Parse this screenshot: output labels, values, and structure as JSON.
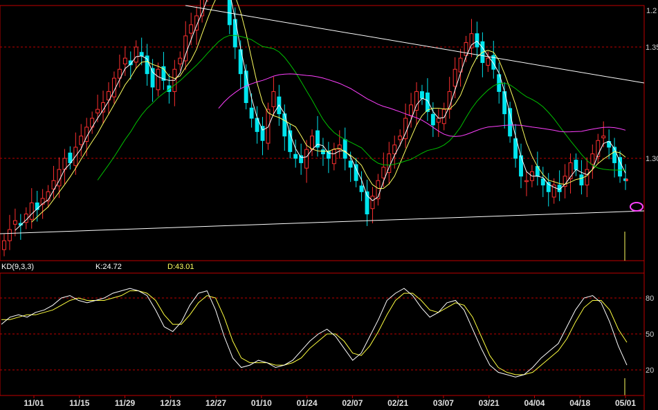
{
  "top_header": {
    "fragments": [
      "",
      "",
      "",
      "",
      ""
    ]
  },
  "main_panel": {
    "price_axis_labels": [
      {
        "text": "1.2",
        "value": 1.4
      },
      {
        "text": "1.35",
        "value": 1.35
      },
      {
        "text": "1.30",
        "value": 1.3
      }
    ]
  },
  "kd_panel": {
    "title": "KD(9,3,3)",
    "k_label": "K:24.72",
    "d_label": "D:43.01",
    "axis_labels": [
      {
        "text": "80",
        "value": 80
      },
      {
        "text": "50",
        "value": 50
      },
      {
        "text": "20",
        "value": 20
      }
    ]
  },
  "x_axis": {
    "labels": [
      "11/01",
      "11/15",
      "11/29",
      "12/13",
      "12/27",
      "01/10",
      "01/24",
      "02/07",
      "02/21",
      "03/07",
      "03/21",
      "04/04",
      "04/18",
      "05/01"
    ]
  },
  "colors": {
    "background": "#000000",
    "grid": "#c00000",
    "bull": "#ff3030",
    "bear": "#00e5ee",
    "ma_short": "#ffffff",
    "ma_mid": "#ffff60",
    "ma_long": "#00c000",
    "ma_longest": "#ff40ff",
    "k_line": "#ffffff",
    "d_line": "#ffff40",
    "trendline": "#ffffff",
    "marker": "#ff40ff"
  },
  "chart_data": [
    {
      "type": "candlestick",
      "title": "",
      "x_labels": [
        "11/01",
        "11/15",
        "11/29",
        "12/13",
        "12/27",
        "01/10",
        "01/24",
        "02/07",
        "02/21",
        "03/07",
        "03/21",
        "04/04",
        "04/18",
        "05/01"
      ],
      "ylim": [
        1.26,
        1.4
      ],
      "close_series": [
        1.263,
        1.268,
        1.272,
        1.27,
        1.275,
        1.28,
        1.277,
        1.282,
        1.285,
        1.29,
        1.295,
        1.3,
        1.298,
        1.305,
        1.31,
        1.314,
        1.318,
        1.322,
        1.325,
        1.33,
        1.336,
        1.34,
        1.345,
        1.342,
        1.35,
        1.346,
        1.338,
        1.332,
        1.34,
        1.335,
        1.33,
        1.34,
        1.345,
        1.355,
        1.36,
        1.364,
        1.372,
        1.38,
        1.383,
        1.386,
        1.378,
        1.36,
        1.35,
        1.338,
        1.325,
        1.318,
        1.312,
        1.308,
        1.322,
        1.33,
        1.32,
        1.31,
        1.303,
        1.3,
        1.298,
        1.304,
        1.31,
        1.305,
        1.302,
        1.3,
        1.304,
        1.306,
        1.3,
        1.296,
        1.29,
        1.285,
        1.275,
        1.283,
        1.29,
        1.296,
        1.302,
        1.306,
        1.31,
        1.318,
        1.324,
        1.33,
        1.327,
        1.321,
        1.315,
        1.318,
        1.322,
        1.33,
        1.34,
        1.345,
        1.352,
        1.356,
        1.35,
        1.343,
        1.345,
        1.34,
        1.33,
        1.32,
        1.31,
        1.3,
        1.292,
        1.29,
        1.294,
        1.292,
        1.288,
        1.285,
        1.288,
        1.285,
        1.292,
        1.298,
        1.295,
        1.288,
        1.295,
        1.302,
        1.308,
        1.31,
        1.305,
        1.298,
        1.292,
        1.29
      ],
      "moving_averages": [
        "short",
        "mid",
        "long",
        "longest"
      ],
      "trendlines": 2
    },
    {
      "type": "line",
      "title": "KD(9,3,3)",
      "ylim": [
        0,
        100
      ],
      "series": [
        {
          "name": "K",
          "last": 24.72,
          "values": [
            58,
            64,
            66,
            64,
            68,
            70,
            74,
            80,
            82,
            78,
            76,
            78,
            80,
            84,
            86,
            88,
            86,
            82,
            70,
            56,
            52,
            60,
            74,
            84,
            86,
            70,
            48,
            30,
            22,
            24,
            28,
            26,
            22,
            24,
            28,
            36,
            44,
            50,
            54,
            48,
            38,
            28,
            34,
            48,
            62,
            78,
            84,
            88,
            82,
            72,
            64,
            68,
            76,
            78,
            70,
            54,
            38,
            24,
            18,
            16,
            14,
            16,
            22,
            30,
            36,
            42,
            56,
            70,
            80,
            82,
            76,
            60,
            40,
            24
          ]
        },
        {
          "name": "D",
          "last": 43.01,
          "values": [
            62,
            62,
            64,
            66,
            66,
            68,
            70,
            74,
            78,
            80,
            78,
            78,
            78,
            80,
            82,
            86,
            86,
            84,
            78,
            66,
            58,
            58,
            66,
            76,
            82,
            80,
            64,
            44,
            30,
            26,
            26,
            26,
            24,
            24,
            26,
            30,
            38,
            44,
            50,
            50,
            44,
            34,
            32,
            40,
            52,
            66,
            78,
            84,
            84,
            78,
            70,
            68,
            72,
            76,
            74,
            64,
            48,
            32,
            22,
            18,
            16,
            16,
            18,
            24,
            30,
            36,
            46,
            60,
            72,
            78,
            78,
            70,
            54,
            43
          ]
        }
      ],
      "reference_levels": [
        80,
        50,
        20
      ]
    }
  ]
}
